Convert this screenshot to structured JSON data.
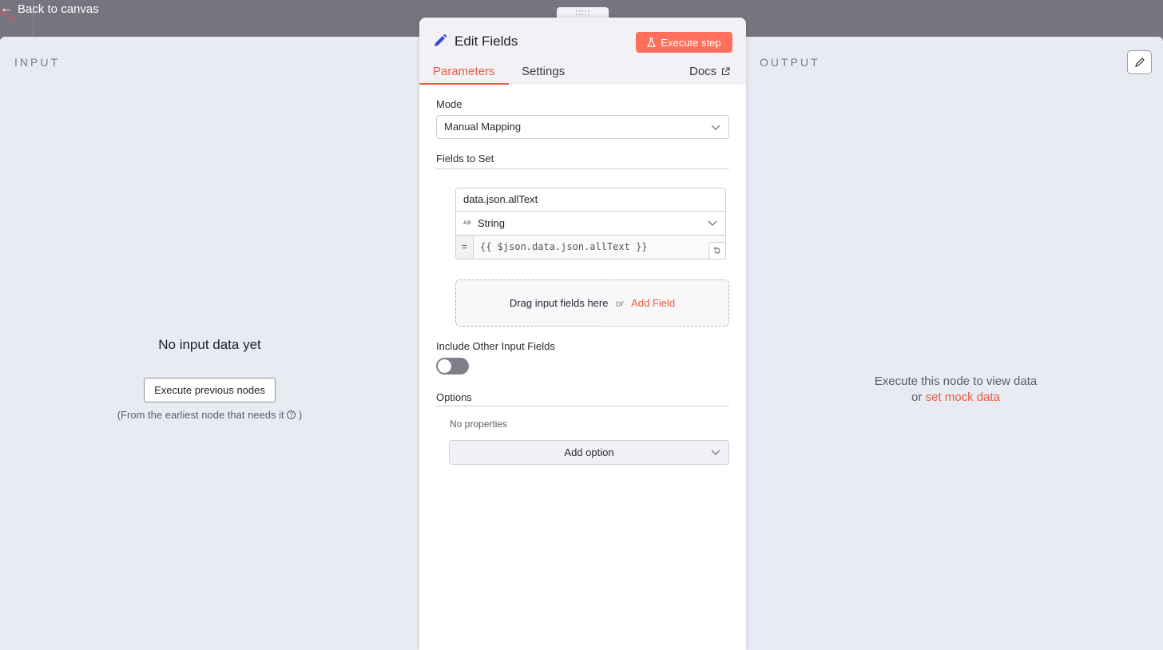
{
  "header": {
    "back_label": "Back to canvas"
  },
  "input_pane": {
    "title": "INPUT",
    "empty_headline": "No input data yet",
    "execute_previous_label": "Execute previous nodes",
    "hint_prefix": "(From the earliest node that needs it",
    "hint_suffix": ")"
  },
  "output_pane": {
    "title": "OUTPUT",
    "empty_line1": "Execute this node to view data",
    "empty_or": "or",
    "mock_link": "set mock data"
  },
  "node": {
    "title": "Edit Fields",
    "execute_label": "Execute step",
    "tabs": [
      {
        "label": "Parameters",
        "active": true
      },
      {
        "label": "Settings",
        "active": false
      }
    ],
    "docs_label": "Docs",
    "mode": {
      "label": "Mode",
      "value": "Manual Mapping"
    },
    "fields_to_set": {
      "label": "Fields to Set",
      "assignment": {
        "name": "data.json.allText",
        "type_badge": "AB",
        "type": "String",
        "equals": "=",
        "expression": "{{ $json.data.json.allText }}"
      },
      "dropzone_text": "Drag input fields here",
      "dropzone_or": "or",
      "add_field_label": "Add Field"
    },
    "include_other": {
      "label": "Include Other Input Fields",
      "enabled": false
    },
    "options": {
      "label": "Options",
      "empty_text": "No properties",
      "add_option_label": "Add option"
    }
  },
  "colors": {
    "accent": "#ea5a3f",
    "execute_button": "#ff6f5c",
    "pencil": "#3b48d6"
  }
}
